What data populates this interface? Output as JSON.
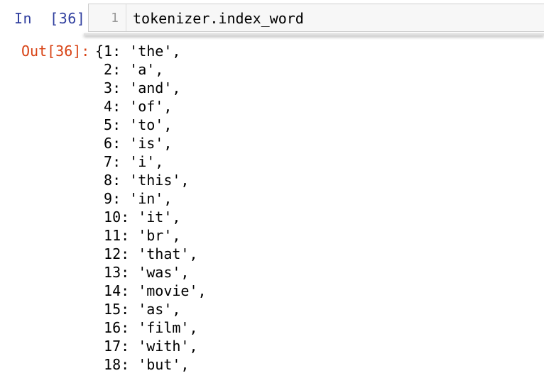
{
  "input": {
    "prompt": "In  [36]:",
    "line_number": "1",
    "code": "tokenizer.index_word"
  },
  "output": {
    "prompt": "Out[36]:",
    "open_brace": "{",
    "items": [
      {
        "key": "1:",
        "value": "'the',"
      },
      {
        "key": "2:",
        "value": "'a',"
      },
      {
        "key": "3:",
        "value": "'and',"
      },
      {
        "key": "4:",
        "value": "'of',"
      },
      {
        "key": "5:",
        "value": "'to',"
      },
      {
        "key": "6:",
        "value": "'is',"
      },
      {
        "key": "7:",
        "value": "'i',"
      },
      {
        "key": "8:",
        "value": "'this',"
      },
      {
        "key": "9:",
        "value": "'in',"
      },
      {
        "key": "10:",
        "value": "'it',"
      },
      {
        "key": "11:",
        "value": "'br',"
      },
      {
        "key": "12:",
        "value": "'that',"
      },
      {
        "key": "13:",
        "value": "'was',"
      },
      {
        "key": "14:",
        "value": "'movie',"
      },
      {
        "key": "15:",
        "value": "'as',"
      },
      {
        "key": "16:",
        "value": "'film',"
      },
      {
        "key": "17:",
        "value": "'with',"
      },
      {
        "key": "18:",
        "value": "'but',"
      }
    ]
  },
  "colors": {
    "in_prompt": "#303f9f",
    "out_prompt": "#d84315",
    "editor_bg": "#f7f7f7"
  }
}
